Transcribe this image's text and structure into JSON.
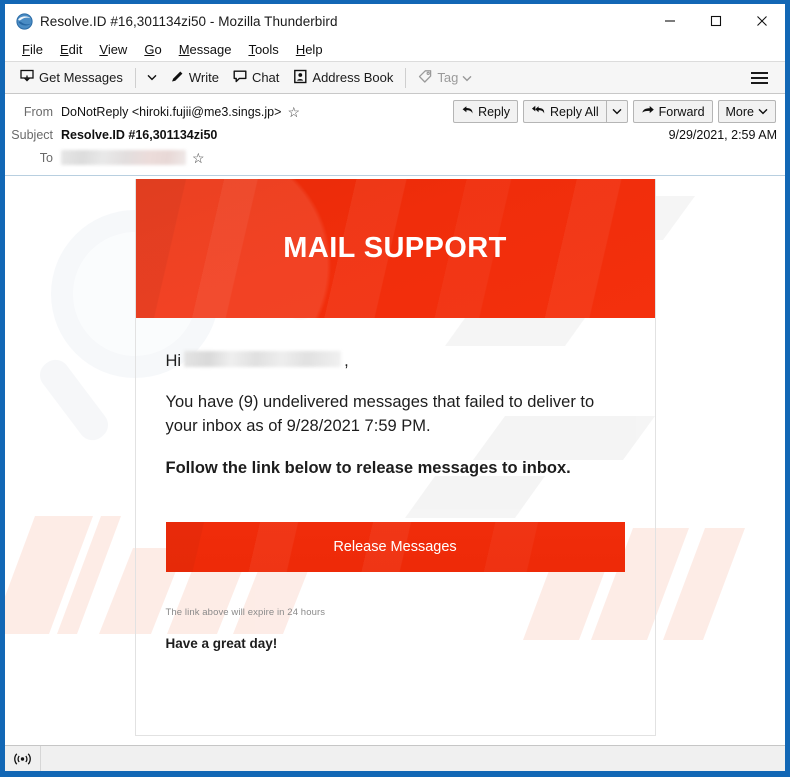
{
  "window": {
    "title": "Resolve.ID #16,301134zi50 - Mozilla Thunderbird",
    "app_icon": "thunderbird-icon",
    "minimize_label": "─",
    "maximize_label": "□",
    "close_label": "✕",
    "frame_color": "#1267b5"
  },
  "menubar": {
    "items": [
      {
        "label": "File",
        "accesskey": "F"
      },
      {
        "label": "Edit",
        "accesskey": "E"
      },
      {
        "label": "View",
        "accesskey": "V"
      },
      {
        "label": "Go",
        "accesskey": "G"
      },
      {
        "label": "Message",
        "accesskey": "M"
      },
      {
        "label": "Tools",
        "accesskey": "T"
      },
      {
        "label": "Help",
        "accesskey": "H"
      }
    ]
  },
  "toolbar": {
    "get_messages_label": "Get Messages",
    "get_messages_icon": "download-mail-icon",
    "get_messages_caret": "⌄",
    "write_label": "Write",
    "write_icon": "pencil-icon",
    "chat_label": "Chat",
    "chat_icon": "speech-bubble-icon",
    "address_book_label": "Address Book",
    "address_book_icon": "address-book-icon",
    "tag_label": "Tag",
    "tag_icon": "tag-icon",
    "tag_caret": "⌄",
    "app_menu_icon": "hamburger-menu-icon"
  },
  "message_header": {
    "from_label": "From",
    "from_value": "DoNotReply <hiroki.fujii@me3.sings.jp>",
    "subject_label": "Subject",
    "subject_value": "Resolve.ID #16,301134zi50",
    "to_label": "To",
    "to_value_redacted": "",
    "date": "9/29/2021, 2:59 AM",
    "star_icon": "star-outline-icon",
    "actions": {
      "reply_label": "Reply",
      "reply_icon": "reply-arrow-icon",
      "reply_all_label": "Reply All",
      "reply_all_icon": "reply-all-arrow-icon",
      "reply_all_caret": "⌄",
      "forward_label": "Forward",
      "forward_icon": "forward-arrow-icon",
      "more_label": "More",
      "more_caret": "⌄"
    }
  },
  "email": {
    "banner_title": "MAIL SUPPORT",
    "banner_color": "#F02C0A",
    "greeting_prefix": "Hi",
    "greeting_name_redacted": "",
    "greeting_suffix": ",",
    "paragraph_1": "You have (9) undelivered messages that failed to deliver to your inbox as of 9/28/2021 7:59 PM.",
    "paragraph_2": "Follow the link below to release messages to inbox.",
    "cta_label": "Release Messages",
    "cta_color": "#F02C0A",
    "expire_note": "The link above will expire in 24 hours",
    "closing": "Have a great day!",
    "undelivered_count": "9",
    "failed_delivery_time": "9/28/2021 7:59 PM"
  },
  "statusbar": {
    "icon": "broadcast-signal-icon",
    "text": ""
  }
}
